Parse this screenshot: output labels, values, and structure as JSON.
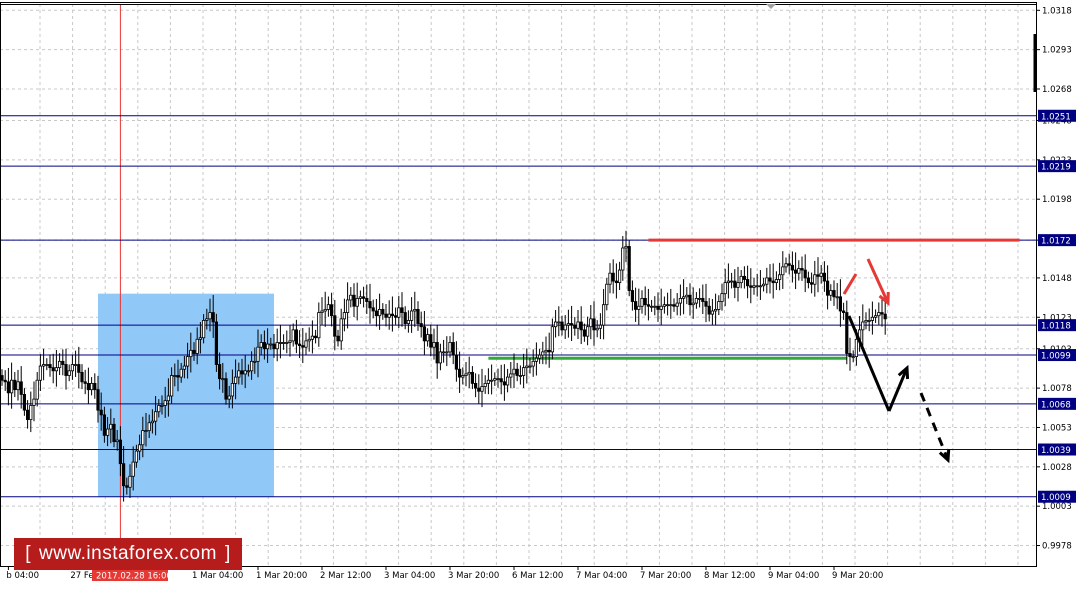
{
  "chart_data": {
    "type": "candlestick",
    "symbol": "",
    "ylim": [
      0.9965,
      1.0322
    ],
    "y_ticks": [
      1.0318,
      1.0293,
      1.0268,
      1.0248,
      1.0223,
      1.0198,
      1.0172,
      1.0148,
      1.0123,
      1.0103,
      1.0078,
      1.0053,
      1.0028,
      1.0003,
      0.9978
    ],
    "y_tick_labels": [
      "1.0318",
      "1.0293",
      "1.0268",
      "1.0248",
      "1.0223",
      "1.0198",
      "1.0172",
      "1.0148",
      "1.0123",
      "1.0103",
      "1.0078",
      "1.0053",
      "1.0028",
      "1.0003",
      "0.9978"
    ],
    "x_tick_labels": [
      "b 04:00",
      "27 Feb 20",
      "2017.02.28 16:00",
      "1 Mar 04:00",
      "1 Mar 20:00",
      "2 Mar 12:00",
      "3 Mar 04:00",
      "3 Mar 20:00",
      "6 Mar 12:00",
      "7 Mar 04:00",
      "7 Mar 20:00",
      "8 Mar 12:00",
      "9 Mar 04:00",
      "9 Mar 20:00"
    ],
    "x_tick_index": [
      2,
      22,
      40,
      60,
      80,
      100,
      120,
      140,
      160,
      180,
      200,
      220,
      240,
      260
    ],
    "highlighted_x_label": "2017.02.28 16:00",
    "levels": [
      {
        "value": 1.0251,
        "label": "1.0251",
        "color": "#000080"
      },
      {
        "value": 1.0219,
        "label": "1.0219",
        "color": "#000080"
      },
      {
        "value": 1.0172,
        "label": "1.0172",
        "color": "#000080"
      },
      {
        "value": 1.0118,
        "label": "1.0118",
        "color": "#000080"
      },
      {
        "value": 1.0099,
        "label": "1.0099",
        "color": "#000080"
      },
      {
        "value": 1.0068,
        "label": "1.0068",
        "color": "#000080"
      },
      {
        "value": 1.0039,
        "label": "1.0039",
        "color": "#000080"
      },
      {
        "value": 1.0009,
        "label": "1.0009",
        "color": "#000080"
      }
    ],
    "resistance_line": {
      "value": 1.0172,
      "from_index": 202,
      "to_index": 318,
      "color": "#e53935"
    },
    "support_line": {
      "value": 1.0097,
      "from_index": 152,
      "to_index": 264,
      "color": "#2eab3a"
    },
    "highlight_box": {
      "from_index": 30,
      "to_index": 85,
      "y_top": 1.0138,
      "y_bottom": 1.0009,
      "color": "#90c8f8"
    },
    "cursor_index": 37,
    "cursor_color": "#e53935",
    "grid": true,
    "colors": {
      "candle": "#000000",
      "bg": "#ffffff",
      "grid": "#c8c8c8",
      "level": "#000080",
      "arrow_red": "#e53935",
      "arrow_black": "#000000"
    },
    "closes": [
      1.0083,
      1.0082,
      1.0075,
      1.0083,
      1.0077,
      1.0082,
      1.0074,
      1.0064,
      1.0058,
      1.0067,
      1.0071,
      1.0083,
      1.0092,
      1.0093,
      1.0093,
      1.0091,
      1.0089,
      1.0091,
      1.0095,
      1.0093,
      1.0086,
      1.0089,
      1.0093,
      1.0093,
      1.0088,
      1.0082,
      1.0081,
      1.0077,
      1.0081,
      1.0077,
      1.0064,
      1.0061,
      1.0048,
      1.0052,
      1.0055,
      1.0044,
      1.0045,
      1.003,
      1.0016,
      1.0015,
      1.0022,
      1.0031,
      1.0038,
      1.0042,
      1.0051,
      1.0051,
      1.0056,
      1.0057,
      1.0063,
      1.0067,
      1.0067,
      1.007,
      1.0073,
      1.0086,
      1.0086,
      1.0085,
      1.009,
      1.0092,
      1.0098,
      1.0102,
      1.01,
      1.0109,
      1.011,
      1.0121,
      1.0122,
      1.0126,
      1.012,
      1.0093,
      1.0084,
      1.0084,
      1.0071,
      1.0073,
      1.0081,
      1.0085,
      1.0089,
      1.0087,
      1.0089,
      1.0089,
      1.0095,
      1.0095,
      1.0104,
      1.0107,
      1.0103,
      1.0106,
      1.0106,
      1.0103,
      1.0107,
      1.0107,
      1.0107,
      1.0107,
      1.0108,
      1.0115,
      1.0106,
      1.0105,
      1.0104,
      1.0108,
      1.0109,
      1.0111,
      1.011,
      1.0126,
      1.0127,
      1.0128,
      1.0131,
      1.0124,
      1.0111,
      1.0108,
      1.0122,
      1.0126,
      1.0134,
      1.0137,
      1.013,
      1.0135,
      1.0136,
      1.0135,
      1.0133,
      1.0129,
      1.0127,
      1.0124,
      1.0128,
      1.0125,
      1.0123,
      1.0125,
      1.0124,
      1.0123,
      1.0129,
      1.0126,
      1.0119,
      1.0121,
      1.0127,
      1.0128,
      1.0119,
      1.0117,
      1.0108,
      1.0112,
      1.0104,
      1.0107,
      1.0094,
      1.0101,
      1.0101,
      1.0101,
      1.0107,
      1.0099,
      1.009,
      1.0085,
      1.0086,
      1.0087,
      1.0088,
      1.0081,
      1.0078,
      1.0076,
      1.0079,
      1.0081,
      1.0083,
      1.0083,
      1.0084,
      1.0084,
      1.0082,
      1.008,
      1.0085,
      1.0087,
      1.009,
      1.0086,
      1.0086,
      1.0091,
      1.0092,
      1.0092,
      1.0095,
      1.0097,
      1.0099,
      1.0101,
      1.0102,
      1.0101,
      1.0117,
      1.012,
      1.012,
      1.0115,
      1.0118,
      1.0119,
      1.0118,
      1.0116,
      1.012,
      1.0115,
      1.0111,
      1.0117,
      1.0122,
      1.0115,
      1.0116,
      1.0118,
      1.0131,
      1.0144,
      1.0151,
      1.0146,
      1.0145,
      1.0153,
      1.0167,
      1.0168,
      1.014,
      1.0133,
      1.0128,
      1.013,
      1.0135,
      1.0131,
      1.013,
      1.013,
      1.013,
      1.0128,
      1.013,
      1.0131,
      1.0131,
      1.0131,
      1.013,
      1.0132,
      1.0135,
      1.0136,
      1.0137,
      1.0131,
      1.0132,
      1.0135,
      1.0135,
      1.0133,
      1.013,
      1.0125,
      1.0127,
      1.0128,
      1.0133,
      1.0138,
      1.0145,
      1.0146,
      1.0146,
      1.0142,
      1.0145,
      1.0149,
      1.0147,
      1.0143,
      1.0142,
      1.0143,
      1.0143,
      1.0143,
      1.0144,
      1.0148,
      1.0146,
      1.0145,
      1.0147,
      1.015,
      1.0155,
      1.0157,
      1.0156,
      1.0153,
      1.0151,
      1.0154,
      1.0153,
      1.0148,
      1.0145,
      1.0144,
      1.015,
      1.0149,
      1.0151,
      1.0146,
      1.0137,
      1.014,
      1.0136,
      1.0136,
      1.0127,
      1.0126,
      1.01,
      1.0098,
      1.0098,
      1.0109,
      1.0115,
      1.012,
      1.0121,
      1.0121,
      1.0123,
      1.0124,
      1.0126,
      1.0125,
      1.0122
    ]
  },
  "watermark": {
    "left": "[",
    "text": "www.instaforex.com",
    "right": "]"
  }
}
